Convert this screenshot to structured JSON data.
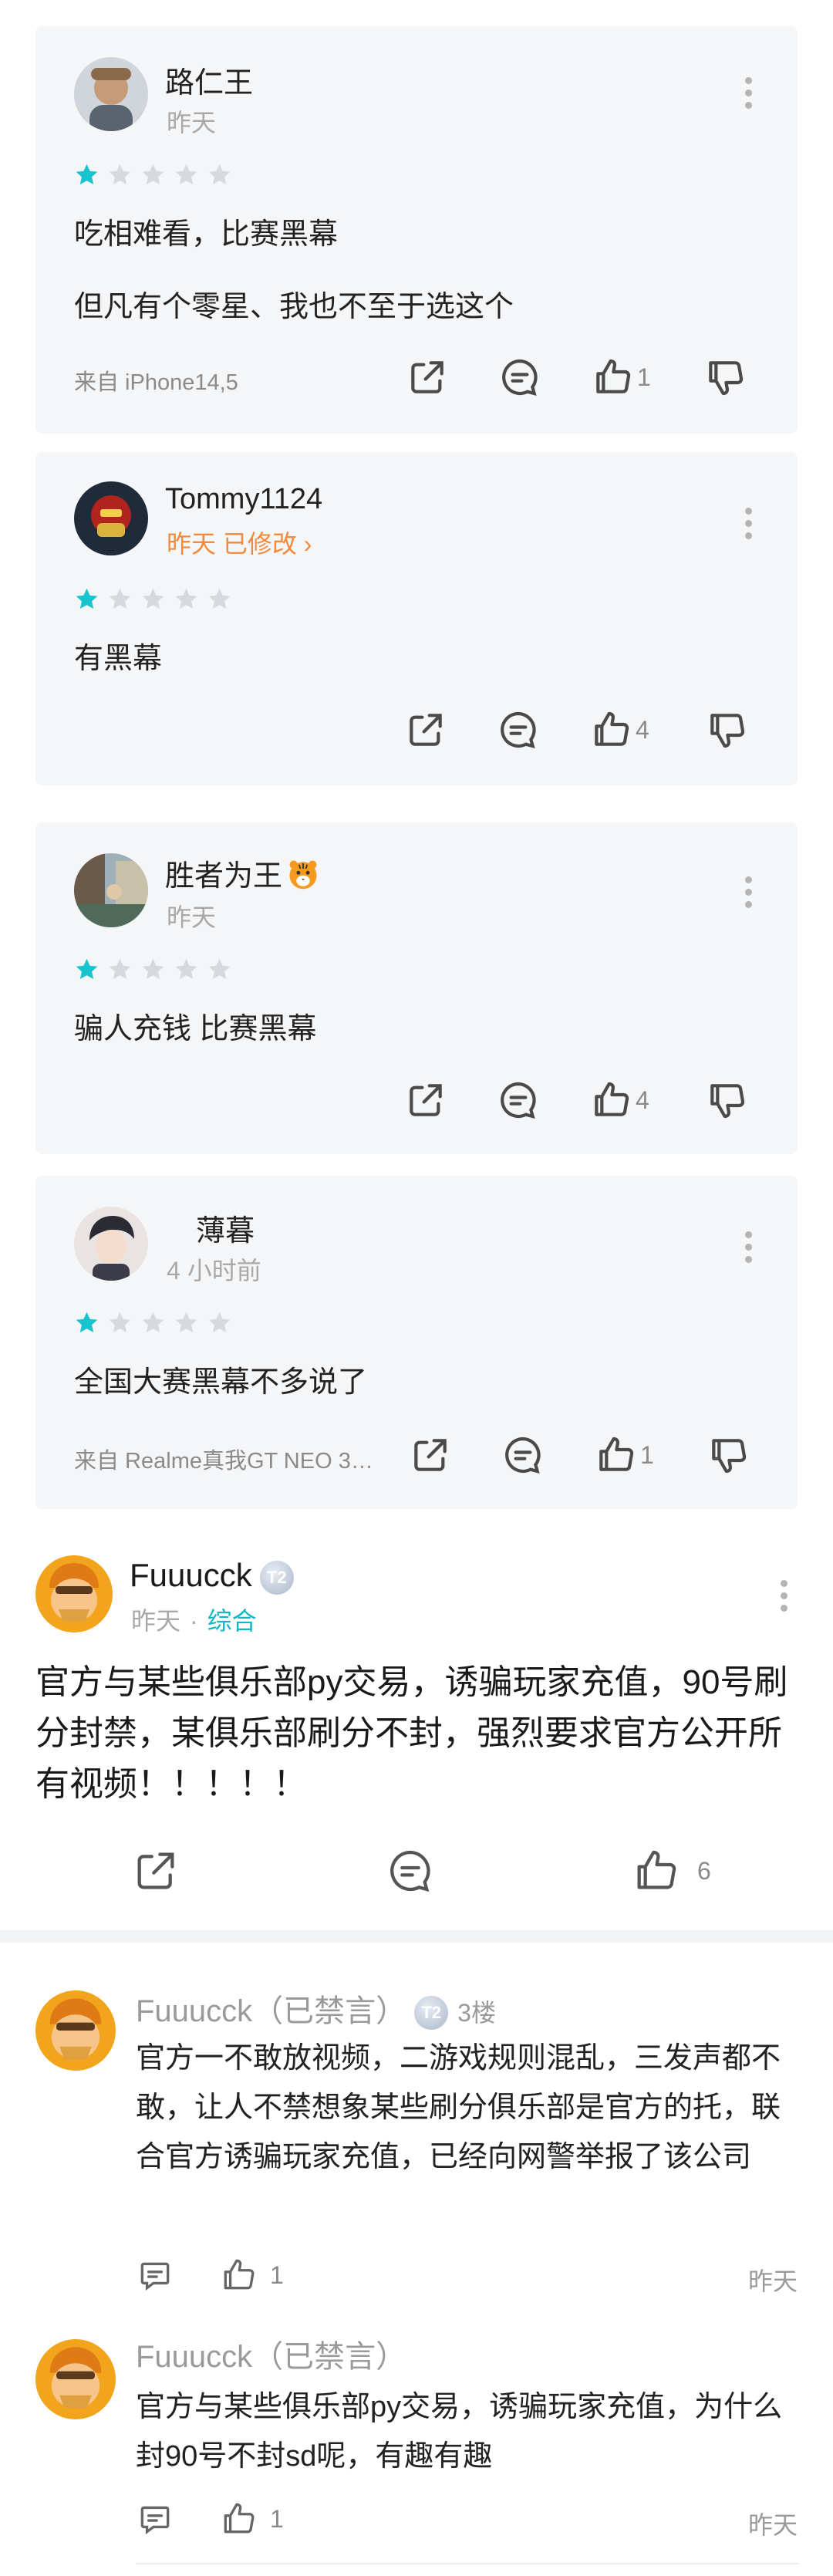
{
  "reviews": [
    {
      "username": "路仁王",
      "time": "昨天",
      "rating": 1,
      "lines": [
        "吃相难看，比赛黑幕",
        "但凡有个零星、我也不至于选这个"
      ],
      "source": "来自 iPhone14,5",
      "likes": "1"
    },
    {
      "username": "Tommy1124",
      "time": "昨天 已修改 ›",
      "rating": 1,
      "lines": [
        "有黑幕"
      ],
      "source": "",
      "likes": "4"
    },
    {
      "username": "胜者为王",
      "time": "昨天",
      "rating": 1,
      "lines": [
        "骗人充钱 比赛黑幕"
      ],
      "source": "",
      "likes": "4"
    },
    {
      "username": "薄暮",
      "time": "4 小时前",
      "rating": 1,
      "lines": [
        "全国大赛黑幕不多说了"
      ],
      "source": "来自 Realme真我GT NEO 3…",
      "likes": "1"
    }
  ],
  "post": {
    "username": "Fuuucck",
    "badge": "T2",
    "time": "昨天",
    "separator": "·",
    "category": "综合",
    "body": "官方与某些俱乐部py交易，诱骗玩家充值，90号刷分封禁，某俱乐部刷分不封，强烈要求官方公开所有视频！！！！！",
    "likes": "6"
  },
  "comments": [
    {
      "username": "Fuuucck（已禁言）",
      "badge": "T2",
      "floor": "3楼",
      "body": "官方一不敢放视频，二游戏规则混乱，三发声都不敢，让人不禁想象某些刷分俱乐部是官方的托，联合官方诱骗玩家充值，已经向网警举报了该公司",
      "likes": "1",
      "time": "昨天"
    },
    {
      "username": "Fuuucck（已禁言）",
      "badge": "",
      "floor": "",
      "body": "官方与某些俱乐部py交易，诱骗玩家充值，为什么封90号不封sd呢，有趣有趣",
      "likes": "1",
      "time": "昨天"
    }
  ],
  "colors": {
    "star_active": "#17c3cf",
    "star_inactive": "#d6d9de",
    "edited": "#f08a3c",
    "category": "#11b8c4"
  }
}
